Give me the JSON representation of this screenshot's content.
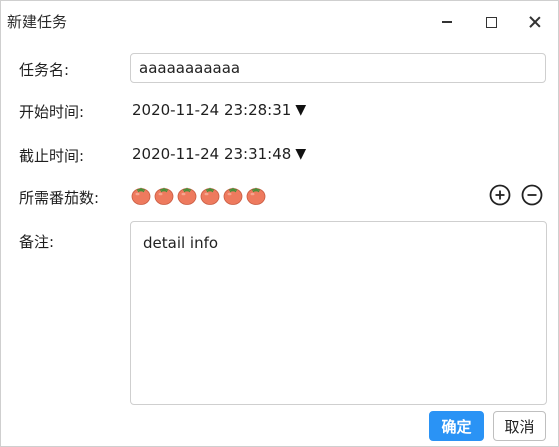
{
  "window": {
    "title": "新建任务"
  },
  "form": {
    "task_name_label": "任务名:",
    "task_name_value": "aaaaaaaaaaa",
    "start_time_label": "开始时间:",
    "start_time_value": "2020-11-24 23:28:31",
    "end_time_label": "截止时间:",
    "end_time_value": "2020-11-24 23:31:48",
    "dropdown_caret": "▼",
    "tomato_label": "所需番茄数:",
    "tomato_count": 6,
    "notes_label": "备注:",
    "notes_value": "detail info"
  },
  "buttons": {
    "ok_label": "确定",
    "cancel_label": "取消"
  },
  "colors": {
    "accent": "#2a93f5",
    "tomato": "#ee7a5e",
    "tomato_leaf": "#4b8f3a"
  },
  "icons": {
    "minimize": "minimize-icon",
    "maximize": "maximize-icon",
    "close": "close-icon",
    "tomato": "tomato-icon",
    "increase": "plus-circle-icon",
    "decrease": "minus-circle-icon"
  }
}
